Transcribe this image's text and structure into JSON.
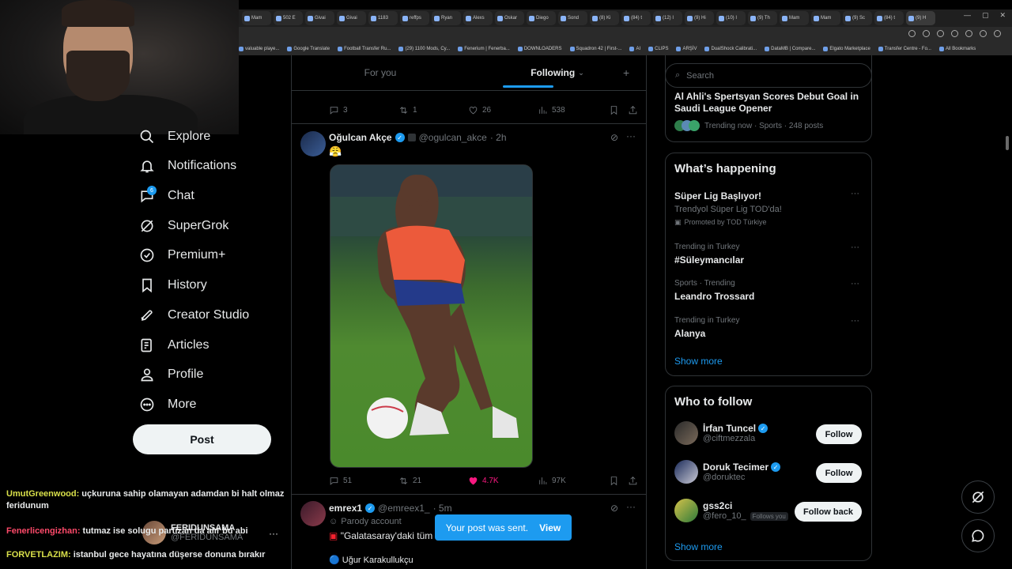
{
  "browser": {
    "tabs": [
      "Mam",
      "502 E",
      "Givai",
      "Givai",
      "1183",
      "reffps",
      "Ryan",
      "Alexs",
      "Oskar",
      "Diego",
      "Sond",
      "(8) Ki",
      "(84) t",
      "(12) I",
      "(9) Hi",
      "(10) I",
      "(9) Th",
      "Mam",
      "Mam",
      "(9) Sc",
      "(84) t",
      "(9) H"
    ],
    "bookmarks": [
      "valuable playe...",
      "Google Translate",
      "Football Transfer Ru...",
      "(29) 1100 Mods, Cy...",
      "Fenerium | Fenerba...",
      "DOWNLOADERS",
      "Squadron 42 | First-...",
      "AI",
      "CLIPS",
      "ARŞİV",
      "DualShock Calibrati...",
      "DataMB | Compare...",
      "Elgato Marketplace",
      "Transfer Centre - Fo..."
    ],
    "all_bookmarks": "All Bookmarks"
  },
  "nav": {
    "items": [
      "Explore",
      "Notifications",
      "Chat",
      "SuperGrok",
      "Premium+",
      "History",
      "Creator Studio",
      "Articles",
      "Profile",
      "More"
    ],
    "chat_badge": "6",
    "post_label": "Post"
  },
  "stream_chat": [
    {
      "user": "UmutGreenwood:",
      "text": "uçkuruna sahip olamayan adamdan bi halt olmaz feridunum",
      "color": "#d9e04a"
    },
    {
      "user": "Fenerlicengizhan:",
      "text": "tutmaz ise solugu partizan da alır bu abi",
      "color": "#ff4a6a"
    },
    {
      "user": "FORVETLAZIM:",
      "text": "istanbul gece hayatına düşerse donuna bırakır",
      "color": "#d9e04a"
    }
  ],
  "mini_account": {
    "name": "FERIDUNSAMA",
    "handle": "@FERIDUNSAMA",
    "more": "···"
  },
  "feed": {
    "tabs": [
      "For you",
      "Following"
    ],
    "plus": "+",
    "top_actions": {
      "replies": "3",
      "reposts": "1",
      "likes": "26",
      "views": "538"
    },
    "tweet1": {
      "name": "Oğulcan Akçe",
      "handle": "@ogulcan_akce",
      "time": "· 2h",
      "text": "😤",
      "actions": {
        "replies": "51",
        "reposts": "21",
        "likes": "4.7K",
        "views": "97K"
      }
    },
    "tweet2": {
      "name": "emrex1",
      "handle": "@emreex1_",
      "time": "· 5m",
      "label": "Parody account",
      "text": "\"Galatasaray'daki tüm t",
      "line2": "🔵 Uğur Karakullukçu"
    }
  },
  "toast": {
    "message": "Your post was sent.",
    "action": "View"
  },
  "sidebar": {
    "search_placeholder": "Search",
    "top_trend": {
      "title": "Al Ahli's Spertsyan Scores Debut Goal in Saudi League Opener",
      "meta": "Trending now · Sports · 248 posts"
    },
    "happening": {
      "title": "What’s happening",
      "promo": {
        "name": "Süper Lig Başlıyor!",
        "desc": "Trendyol Süper Lig TOD'da!",
        "by": "Promoted by TOD Türkiye"
      },
      "trends": [
        {
          "cat": "Trending in Turkey",
          "name": "#Süleymancılar"
        },
        {
          "cat": "Sports · Trending",
          "name": "Leandro Trossard"
        },
        {
          "cat": "Trending in Turkey",
          "name": "Alanya"
        }
      ],
      "show_more": "Show more"
    },
    "who_to_follow": {
      "title": "Who to follow",
      "people": [
        {
          "name": "İrfan Tuncel",
          "handle": "@ciftmezzala",
          "button": "Follow",
          "verified": true
        },
        {
          "name": "Doruk Tecimer",
          "handle": "@doruktec",
          "button": "Follow",
          "verified": true
        },
        {
          "name": "gss2ci",
          "handle": "@fero_10_",
          "badge": "Follows you",
          "button": "Follow back",
          "verified": false
        }
      ],
      "show_more": "Show more"
    }
  },
  "colors": {
    "accent": "#1d9bf0",
    "like": "#f91880",
    "background": "#000000",
    "border": "#2f3336"
  }
}
